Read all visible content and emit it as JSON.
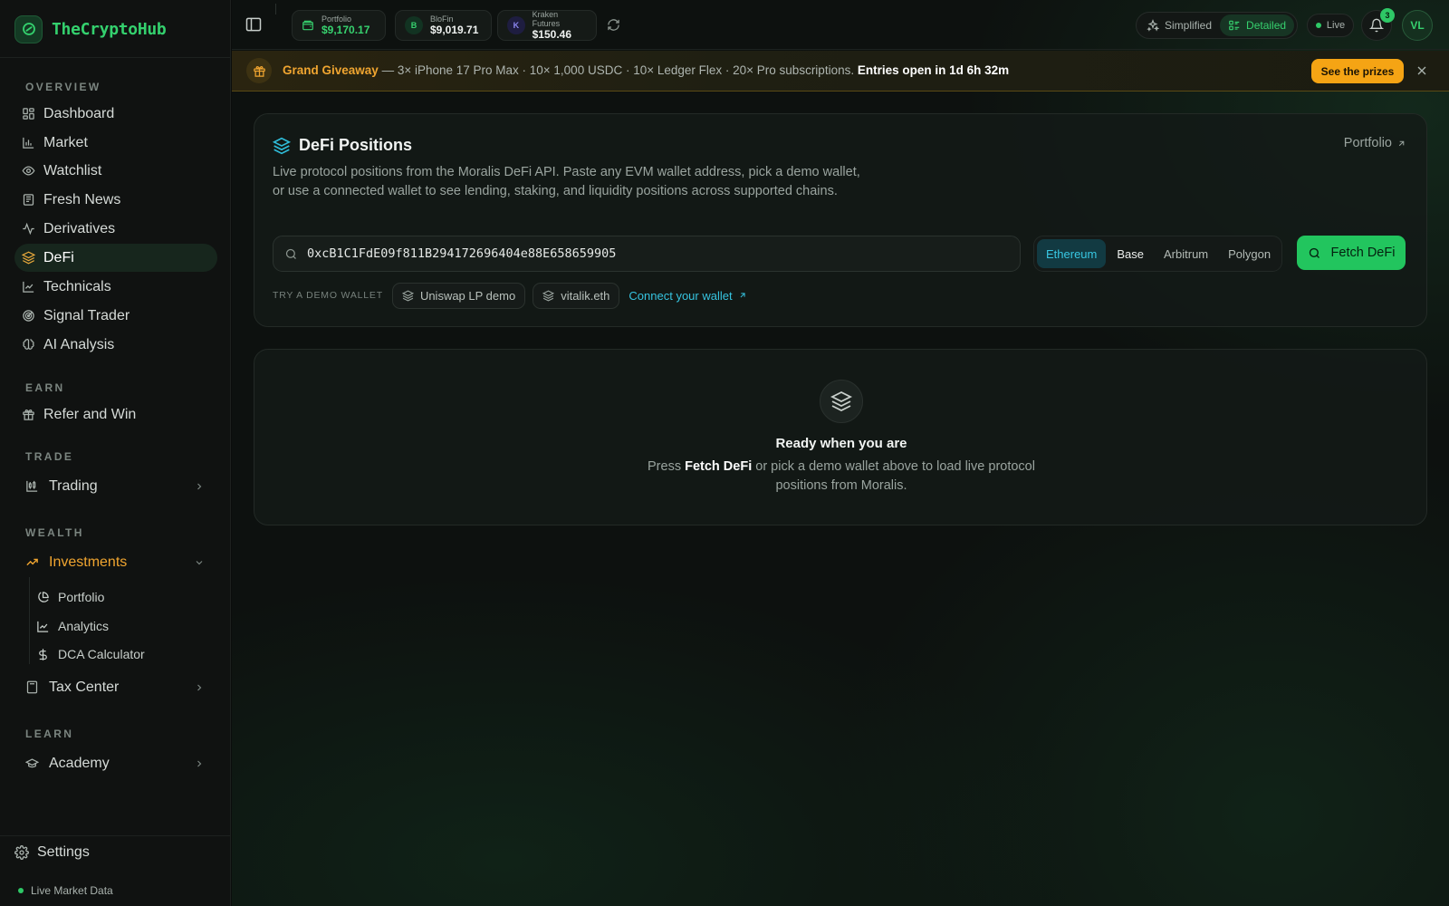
{
  "app": {
    "name": "TheCryptoHub"
  },
  "sidebar": {
    "sections": {
      "overview": "OVERVIEW",
      "earn": "EARN",
      "trade": "TRADE",
      "wealth": "WEALTH",
      "learn": "LEARN"
    },
    "overview_items": [
      {
        "label": "Dashboard",
        "icon": "dashboard-icon"
      },
      {
        "label": "Market",
        "icon": "market-icon"
      },
      {
        "label": "Watchlist",
        "icon": "eye-icon"
      },
      {
        "label": "Fresh News",
        "icon": "newspaper-icon"
      },
      {
        "label": "Derivatives",
        "icon": "activity-icon"
      },
      {
        "label": "DeFi",
        "icon": "layers-icon",
        "active": true
      },
      {
        "label": "Technicals",
        "icon": "line-chart-icon"
      },
      {
        "label": "Signal Trader",
        "icon": "radar-icon"
      },
      {
        "label": "AI Analysis",
        "icon": "brain-icon"
      }
    ],
    "earn_items": [
      {
        "label": "Refer and Win",
        "icon": "gift-icon"
      }
    ],
    "trade_items": [
      {
        "label": "Trading",
        "icon": "candlestick-icon"
      }
    ],
    "wealth_items": [
      {
        "label": "Investments",
        "icon": "trending-up-icon",
        "expanded": true
      }
    ],
    "investments_sub": [
      {
        "label": "Portfolio",
        "icon": "pie-chart-icon"
      },
      {
        "label": "Analytics",
        "icon": "line-chart-icon"
      },
      {
        "label": "DCA Calculator",
        "icon": "dollar-icon"
      }
    ],
    "tax_center": {
      "label": "Tax Center",
      "icon": "calculator-icon"
    },
    "learn_items": [
      {
        "label": "Academy",
        "icon": "graduation-cap-icon"
      }
    ],
    "settings": "Settings",
    "live_market": "Live Market Data"
  },
  "topbar": {
    "accounts": [
      {
        "label": "Portfolio",
        "value": "$9,170.17",
        "badge": ""
      },
      {
        "label": "BloFin",
        "value": "$9,019.71",
        "badge": "B"
      },
      {
        "label": "Kraken Futures",
        "value": "$150.46",
        "badge": "K"
      }
    ],
    "modes": {
      "simplified": "Simplified",
      "detailed": "Detailed",
      "active": "Detailed"
    },
    "live": "Live",
    "notifications": "3",
    "avatar": "VL"
  },
  "banner": {
    "title": "Grand Giveaway",
    "body": " — 3× iPhone 17 Pro Max · 10× 1,000 USDC · 10× Ledger Flex · 20× Pro subscriptions. ",
    "countdown": "Entries open in 1d 6h 32m",
    "cta": "See the prizes"
  },
  "defi": {
    "title": "DeFi Positions",
    "description": "Live protocol positions from the Moralis DeFi API. Paste any EVM wallet address, pick a demo wallet, or use a connected wallet to see lending, staking, and liquidity positions across supported chains.",
    "portfolio_link": "Portfolio",
    "wallet_address": "0xcB1C1FdE09f811B294172696404e88E658659905",
    "chains": [
      "Ethereum",
      "Base",
      "Arbitrum",
      "Polygon"
    ],
    "active_chain": "Ethereum",
    "fetch_button": "Fetch DeFi",
    "demo_label": "TRY A DEMO WALLET",
    "demo_wallets": [
      "Uniswap LP demo",
      "vitalik.eth"
    ],
    "connect_wallet": "Connect your wallet"
  },
  "empty_state": {
    "title": "Ready when you are",
    "desc_pre": "Press ",
    "desc_strong": "Fetch DeFi",
    "desc_post": " or pick a demo wallet above to load live protocol positions from Moralis."
  },
  "colors": {
    "accent_green": "#22c55e",
    "accent_orange": "#f0a530",
    "accent_cyan": "#38c7e3",
    "background": "#0d110f"
  }
}
